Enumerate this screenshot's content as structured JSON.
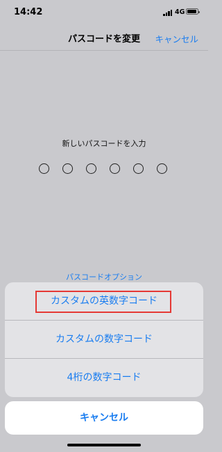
{
  "status": {
    "time": "14:42",
    "network": "4G"
  },
  "nav": {
    "title": "パスコードを変更",
    "cancel": "キャンセル"
  },
  "passcode": {
    "prompt": "新しいパスコードを入力",
    "digits": 6,
    "options_link": "パスコードオプション"
  },
  "sheet": {
    "items": [
      {
        "label": "カスタムの英数字コード",
        "highlighted": true
      },
      {
        "label": "カスタムの数字コード"
      },
      {
        "label": "4桁の数字コード"
      }
    ],
    "cancel": "キャンセル"
  },
  "colors": {
    "accent": "#1a7df0",
    "highlight_border": "#e53935",
    "backdrop": "#c9c9cd"
  }
}
